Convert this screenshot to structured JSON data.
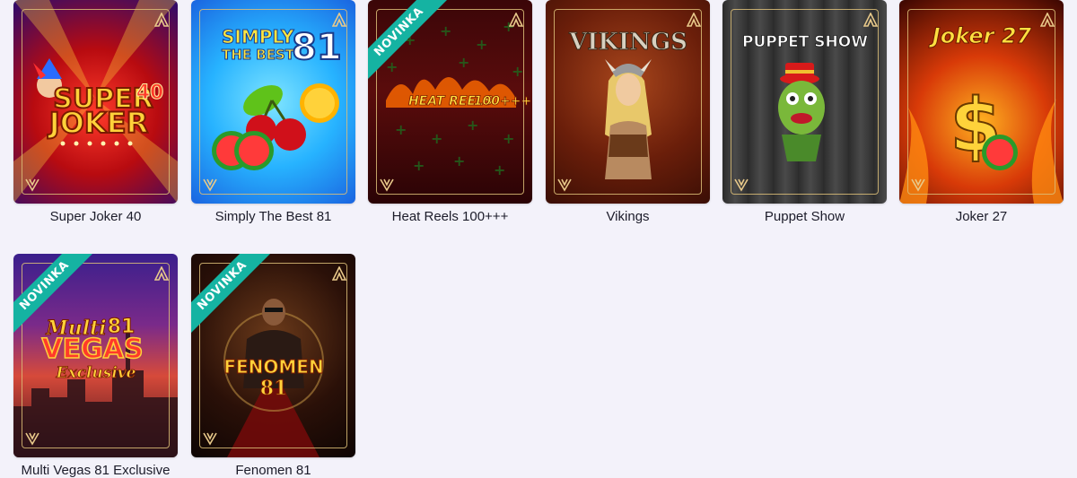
{
  "badge_text": "NOVINKA",
  "games": [
    {
      "title": "Super Joker 40",
      "is_new": false
    },
    {
      "title": "Simply The Best 81",
      "is_new": false
    },
    {
      "title": "Heat Reels 100+++",
      "is_new": true
    },
    {
      "title": "Vikings",
      "is_new": false
    },
    {
      "title": "Puppet Show",
      "is_new": false
    },
    {
      "title": "Joker 27",
      "is_new": false
    },
    {
      "title": "Multi Vegas 81 Exclusive",
      "is_new": true
    },
    {
      "title": "Fenomen 81",
      "is_new": true
    }
  ],
  "art_text": {
    "joker40": {
      "line1": "SUPER",
      "line2": "JOKER",
      "num": "40"
    },
    "simply": {
      "line1": "SIMPLY",
      "line2": "THE BEST",
      "num": "81"
    },
    "heat": {
      "line1": "HEAT REELS",
      "num": "100+++"
    },
    "vikings": {
      "line1": "VIKINGS"
    },
    "puppet": {
      "line1": "PUPPET SHOW"
    },
    "joker27": {
      "line1": "Joker 27"
    },
    "multi": {
      "line1": "Multi",
      "num": "81",
      "line2": "VEGAS",
      "line3": "Exclusive"
    },
    "fenomen": {
      "line1": "FENOMEN",
      "num": "81"
    }
  },
  "colors": {
    "badge": "#15b3a2",
    "page_bg": "#f3f2fa",
    "label": "#1c1c2a",
    "frame": "#dcbe78"
  }
}
